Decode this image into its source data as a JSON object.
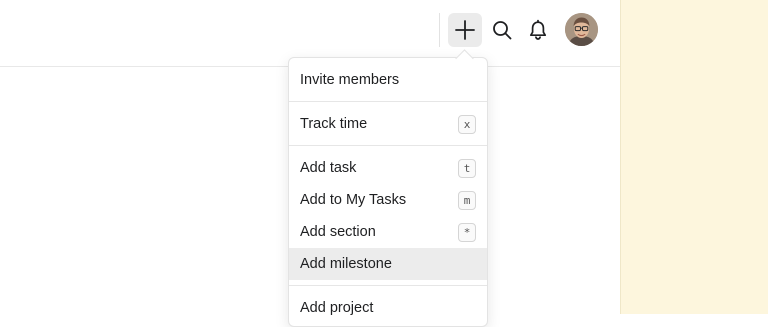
{
  "topbar": {
    "buttons": {
      "create": {
        "icon": "plus-icon",
        "active": true
      },
      "search": {
        "icon": "search-icon"
      },
      "notifications": {
        "icon": "bell-icon"
      }
    },
    "avatar": {
      "icon": "user-avatar"
    }
  },
  "menu": {
    "items": [
      {
        "label": "Invite members",
        "shortcut": ""
      },
      {
        "label": "Track time",
        "shortcut": "x"
      },
      {
        "label": "Add task",
        "shortcut": "t"
      },
      {
        "label": "Add to My Tasks",
        "shortcut": "m"
      },
      {
        "label": "Add section",
        "shortcut": "*"
      },
      {
        "label": "Add milestone",
        "shortcut": ""
      },
      {
        "label": "Add project",
        "shortcut": ""
      }
    ],
    "highlighted_index": 5
  },
  "colors": {
    "side_panel": "#fdf6dd",
    "highlight": "#ececec",
    "active_button": "#ebebeb"
  }
}
